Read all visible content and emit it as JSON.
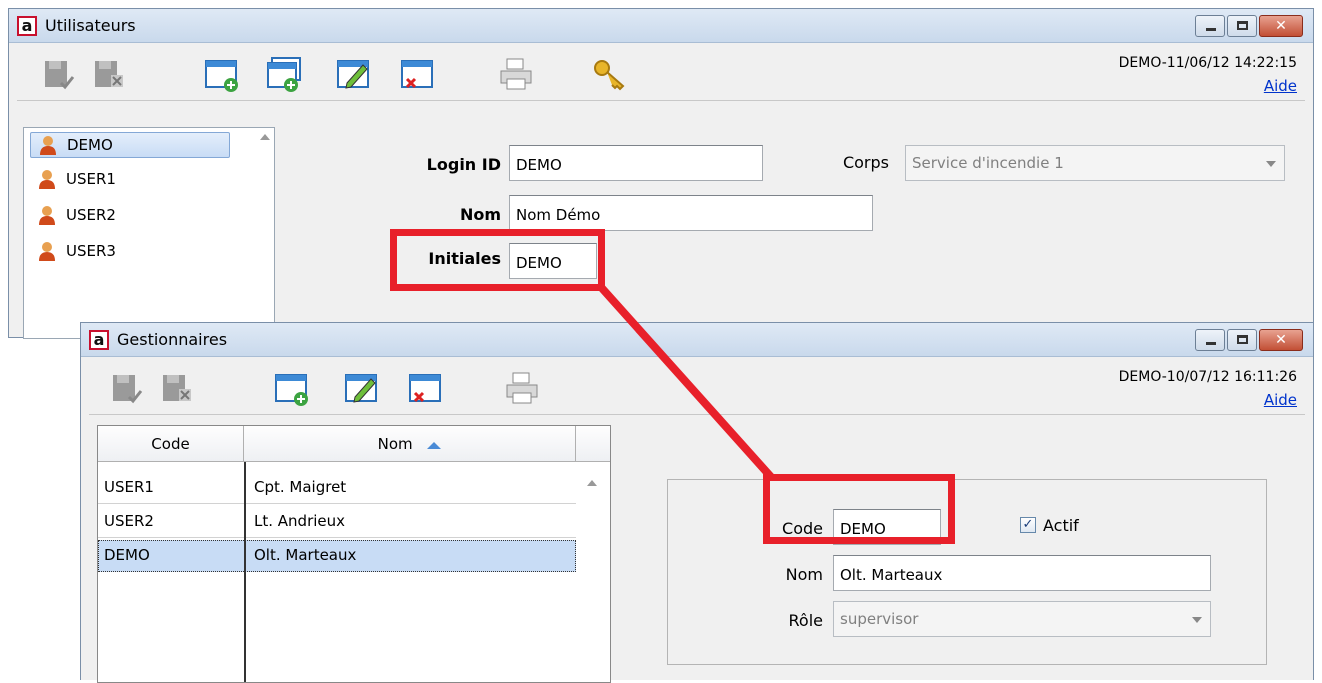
{
  "back_window": {
    "title": "Utilisateurs",
    "timestamp": "DEMO-11/06/12 14:22:15",
    "help_link": "Aide",
    "users": [
      "DEMO",
      "USER1",
      "USER2",
      "USER3"
    ],
    "selected_user": "DEMO",
    "form": {
      "login_label": "Login ID",
      "login_value": "DEMO",
      "corps_label": "Corps",
      "corps_value": "Service d'incendie 1",
      "nom_label": "Nom",
      "nom_value": "Nom Démo",
      "initiales_label": "Initiales",
      "initiales_value": "DEMO"
    }
  },
  "front_window": {
    "title": "Gestionnaires",
    "timestamp": "DEMO-10/07/12 16:11:26",
    "help_link": "Aide",
    "table": {
      "columns": [
        "Code",
        "Nom"
      ],
      "rows": [
        {
          "code": "USER1",
          "nom": "Cpt. Maigret"
        },
        {
          "code": "USER2",
          "nom": "Lt. Andrieux"
        },
        {
          "code": "DEMO",
          "nom": "Olt. Marteaux"
        }
      ],
      "selected_row": 2
    },
    "form": {
      "code_label": "Code",
      "code_value": "DEMO",
      "actif_label": "Actif",
      "actif_checked": true,
      "nom_label": "Nom",
      "nom_value": "Olt. Marteaux",
      "role_label": "Rôle",
      "role_value": "supervisor"
    }
  },
  "colors": {
    "highlight": "#e8202a",
    "selection": "#c8dcf5",
    "link": "#0033cc"
  }
}
